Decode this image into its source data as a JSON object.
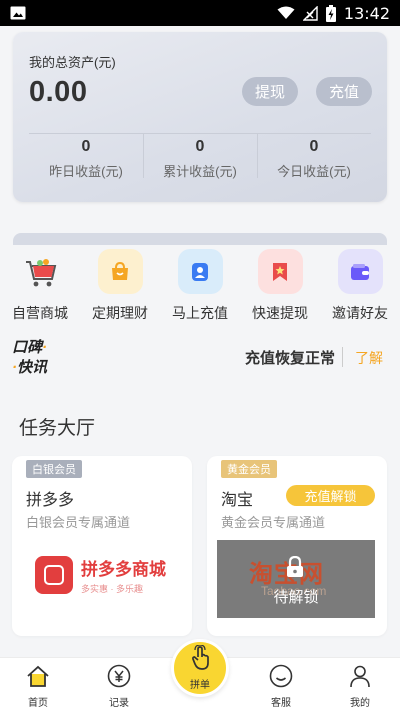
{
  "status_bar": {
    "time": "13:42"
  },
  "asset": {
    "label": "我的总资产(元)",
    "amount": "0.00",
    "withdraw_label": "提现",
    "recharge_label": "充值",
    "stats": [
      {
        "value": "0",
        "caption": "昨日收益(元)"
      },
      {
        "value": "0",
        "caption": "累计收益(元)"
      },
      {
        "value": "0",
        "caption": "今日收益(元)"
      }
    ]
  },
  "quick_menu": [
    {
      "label": "自营商城",
      "icon": "shopping-cart-icon",
      "color": "#e94b4b"
    },
    {
      "label": "定期理财",
      "icon": "wallet-bag-icon",
      "color": "#f5a623"
    },
    {
      "label": "马上充值",
      "icon": "user-card-icon",
      "color": "#3a7bf2"
    },
    {
      "label": "快速提现",
      "icon": "bookmark-star-icon",
      "color": "#e94b4b"
    },
    {
      "label": "邀请好友",
      "icon": "wallet-icon",
      "color": "#6a5af9"
    }
  ],
  "news": {
    "logo_line1": "口碑",
    "logo_line2": "快讯",
    "text": "充值恢复正常",
    "more_label": "了解"
  },
  "task_hall": {
    "title": "任务大厅",
    "cards": [
      {
        "tag": "白银会员",
        "name": "拼多多",
        "sub": "白银会员专属通道",
        "banner_big": "拼多多商城",
        "banner_small": "多实惠 · 多乐趣"
      },
      {
        "tag": "黄金会员",
        "name": "淘宝",
        "sub": "黄金会员专属通道",
        "unlock_label": "充值解锁",
        "banner_big": "淘宝网",
        "banner_small": "Taobao.com",
        "locked_label": "待解锁"
      }
    ]
  },
  "bottom_nav": {
    "items": [
      {
        "label": "首页",
        "icon": "home-icon"
      },
      {
        "label": "记录",
        "icon": "yen-record-icon"
      },
      {
        "label": "拼单",
        "icon": "tap-hand-icon"
      },
      {
        "label": "客服",
        "icon": "smile-service-icon"
      },
      {
        "label": "我的",
        "icon": "person-icon"
      }
    ]
  }
}
